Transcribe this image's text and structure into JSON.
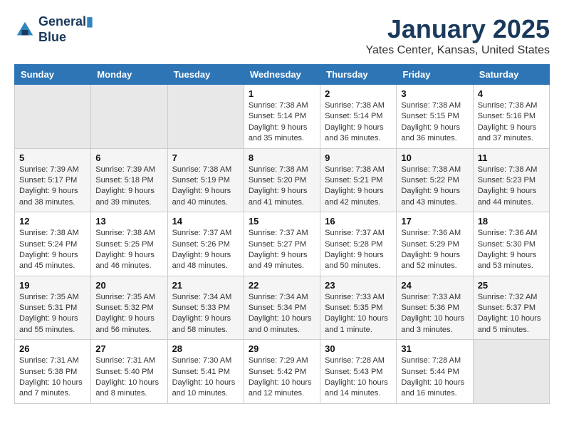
{
  "logo": {
    "line1": "General",
    "line2": "Blue"
  },
  "title": "January 2025",
  "location": "Yates Center, Kansas, United States",
  "weekdays": [
    "Sunday",
    "Monday",
    "Tuesday",
    "Wednesday",
    "Thursday",
    "Friday",
    "Saturday"
  ],
  "weeks": [
    [
      {
        "day": "",
        "info": ""
      },
      {
        "day": "",
        "info": ""
      },
      {
        "day": "",
        "info": ""
      },
      {
        "day": "1",
        "info": "Sunrise: 7:38 AM\nSunset: 5:14 PM\nDaylight: 9 hours and 35 minutes."
      },
      {
        "day": "2",
        "info": "Sunrise: 7:38 AM\nSunset: 5:14 PM\nDaylight: 9 hours and 36 minutes."
      },
      {
        "day": "3",
        "info": "Sunrise: 7:38 AM\nSunset: 5:15 PM\nDaylight: 9 hours and 36 minutes."
      },
      {
        "day": "4",
        "info": "Sunrise: 7:38 AM\nSunset: 5:16 PM\nDaylight: 9 hours and 37 minutes."
      }
    ],
    [
      {
        "day": "5",
        "info": "Sunrise: 7:39 AM\nSunset: 5:17 PM\nDaylight: 9 hours and 38 minutes."
      },
      {
        "day": "6",
        "info": "Sunrise: 7:39 AM\nSunset: 5:18 PM\nDaylight: 9 hours and 39 minutes."
      },
      {
        "day": "7",
        "info": "Sunrise: 7:38 AM\nSunset: 5:19 PM\nDaylight: 9 hours and 40 minutes."
      },
      {
        "day": "8",
        "info": "Sunrise: 7:38 AM\nSunset: 5:20 PM\nDaylight: 9 hours and 41 minutes."
      },
      {
        "day": "9",
        "info": "Sunrise: 7:38 AM\nSunset: 5:21 PM\nDaylight: 9 hours and 42 minutes."
      },
      {
        "day": "10",
        "info": "Sunrise: 7:38 AM\nSunset: 5:22 PM\nDaylight: 9 hours and 43 minutes."
      },
      {
        "day": "11",
        "info": "Sunrise: 7:38 AM\nSunset: 5:23 PM\nDaylight: 9 hours and 44 minutes."
      }
    ],
    [
      {
        "day": "12",
        "info": "Sunrise: 7:38 AM\nSunset: 5:24 PM\nDaylight: 9 hours and 45 minutes."
      },
      {
        "day": "13",
        "info": "Sunrise: 7:38 AM\nSunset: 5:25 PM\nDaylight: 9 hours and 46 minutes."
      },
      {
        "day": "14",
        "info": "Sunrise: 7:37 AM\nSunset: 5:26 PM\nDaylight: 9 hours and 48 minutes."
      },
      {
        "day": "15",
        "info": "Sunrise: 7:37 AM\nSunset: 5:27 PM\nDaylight: 9 hours and 49 minutes."
      },
      {
        "day": "16",
        "info": "Sunrise: 7:37 AM\nSunset: 5:28 PM\nDaylight: 9 hours and 50 minutes."
      },
      {
        "day": "17",
        "info": "Sunrise: 7:36 AM\nSunset: 5:29 PM\nDaylight: 9 hours and 52 minutes."
      },
      {
        "day": "18",
        "info": "Sunrise: 7:36 AM\nSunset: 5:30 PM\nDaylight: 9 hours and 53 minutes."
      }
    ],
    [
      {
        "day": "19",
        "info": "Sunrise: 7:35 AM\nSunset: 5:31 PM\nDaylight: 9 hours and 55 minutes."
      },
      {
        "day": "20",
        "info": "Sunrise: 7:35 AM\nSunset: 5:32 PM\nDaylight: 9 hours and 56 minutes."
      },
      {
        "day": "21",
        "info": "Sunrise: 7:34 AM\nSunset: 5:33 PM\nDaylight: 9 hours and 58 minutes."
      },
      {
        "day": "22",
        "info": "Sunrise: 7:34 AM\nSunset: 5:34 PM\nDaylight: 10 hours and 0 minutes."
      },
      {
        "day": "23",
        "info": "Sunrise: 7:33 AM\nSunset: 5:35 PM\nDaylight: 10 hours and 1 minute."
      },
      {
        "day": "24",
        "info": "Sunrise: 7:33 AM\nSunset: 5:36 PM\nDaylight: 10 hours and 3 minutes."
      },
      {
        "day": "25",
        "info": "Sunrise: 7:32 AM\nSunset: 5:37 PM\nDaylight: 10 hours and 5 minutes."
      }
    ],
    [
      {
        "day": "26",
        "info": "Sunrise: 7:31 AM\nSunset: 5:38 PM\nDaylight: 10 hours and 7 minutes."
      },
      {
        "day": "27",
        "info": "Sunrise: 7:31 AM\nSunset: 5:40 PM\nDaylight: 10 hours and 8 minutes."
      },
      {
        "day": "28",
        "info": "Sunrise: 7:30 AM\nSunset: 5:41 PM\nDaylight: 10 hours and 10 minutes."
      },
      {
        "day": "29",
        "info": "Sunrise: 7:29 AM\nSunset: 5:42 PM\nDaylight: 10 hours and 12 minutes."
      },
      {
        "day": "30",
        "info": "Sunrise: 7:28 AM\nSunset: 5:43 PM\nDaylight: 10 hours and 14 minutes."
      },
      {
        "day": "31",
        "info": "Sunrise: 7:28 AM\nSunset: 5:44 PM\nDaylight: 10 hours and 16 minutes."
      },
      {
        "day": "",
        "info": ""
      }
    ]
  ]
}
